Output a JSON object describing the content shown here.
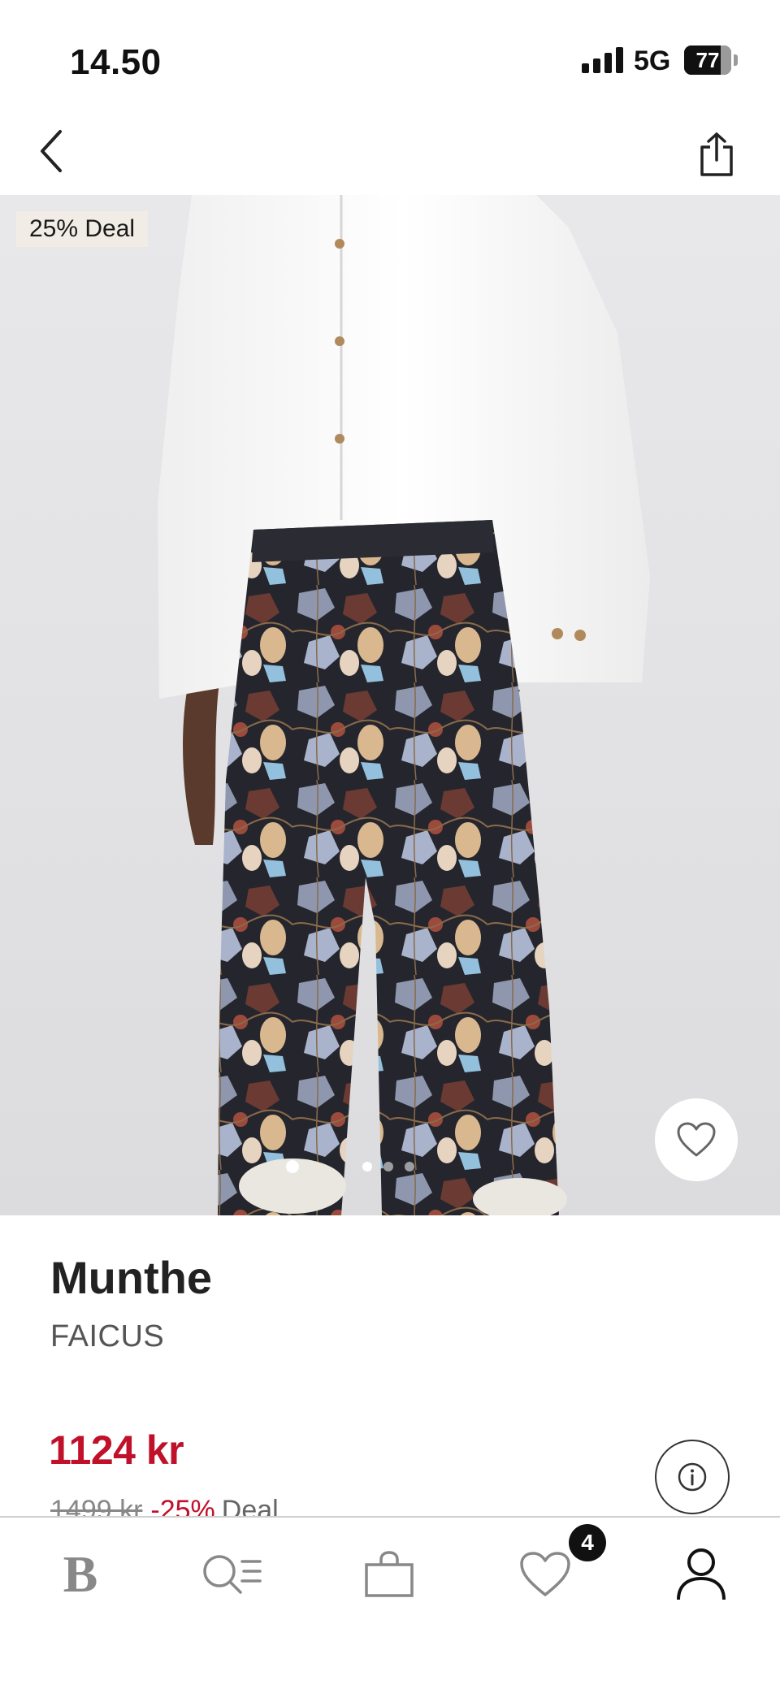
{
  "status_bar": {
    "time": "14.50",
    "network": "5G",
    "battery": "77",
    "battery_level": 0.77
  },
  "hero": {
    "deal_badge": "25% Deal",
    "image_index": 1,
    "image_count": 3
  },
  "product": {
    "brand": "Munthe",
    "name": "FAICUS",
    "price": "1124 kr",
    "old_price": "1499 kr",
    "discount": "-25%",
    "deal_label": "Deal",
    "price_color": "#c0102a"
  },
  "tab_bar": {
    "logo": "B",
    "wishlist_count": "4",
    "icons": [
      "brand-logo-icon",
      "search-menu-icon",
      "shopping-bag-icon",
      "heart-icon",
      "profile-icon"
    ]
  }
}
